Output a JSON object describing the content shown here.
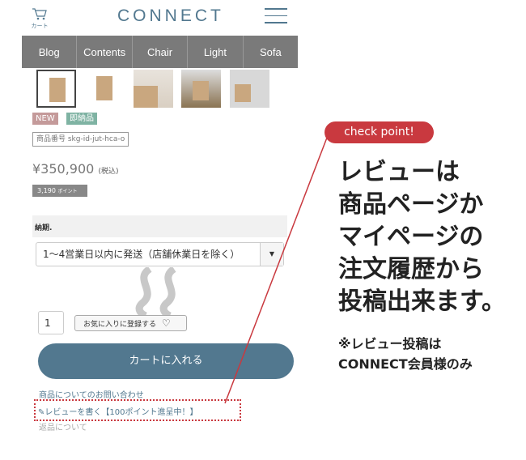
{
  "header": {
    "logo": "CONNECT",
    "cart_label": "カート"
  },
  "nav": [
    "Blog",
    "Contents",
    "Chair",
    "Light",
    "Sofa"
  ],
  "badges": {
    "new": "NEW",
    "instant": "即納品",
    "new_color": "#c49a9a",
    "instant_color": "#7fb3a3"
  },
  "product": {
    "number": "商品番号 skg-id-jut-hca-o",
    "price": "¥350,900",
    "tax": "(税込)",
    "points": "3,190",
    "points_unit": "ポイント"
  },
  "delivery": {
    "label": "納期.",
    "selected": "1〜4営業日以内に発送（店舗休業日を除く）"
  },
  "quantity": "1",
  "favorite": "お気に入りに登録する",
  "cart_button": "カートに入れる",
  "links": [
    "商品についてのお問い合わせ",
    "レビューを書く【100ポイント進呈中！】",
    "返品について"
  ],
  "annotation": {
    "pill": "check point!",
    "lines": [
      "レビューは",
      "商品ページか",
      "マイページの",
      "注文履歴から",
      "投稿出来ます。"
    ],
    "note": [
      "※レビュー投稿は",
      "CONNECT会員様のみ"
    ],
    "accent": "#c9393f"
  }
}
